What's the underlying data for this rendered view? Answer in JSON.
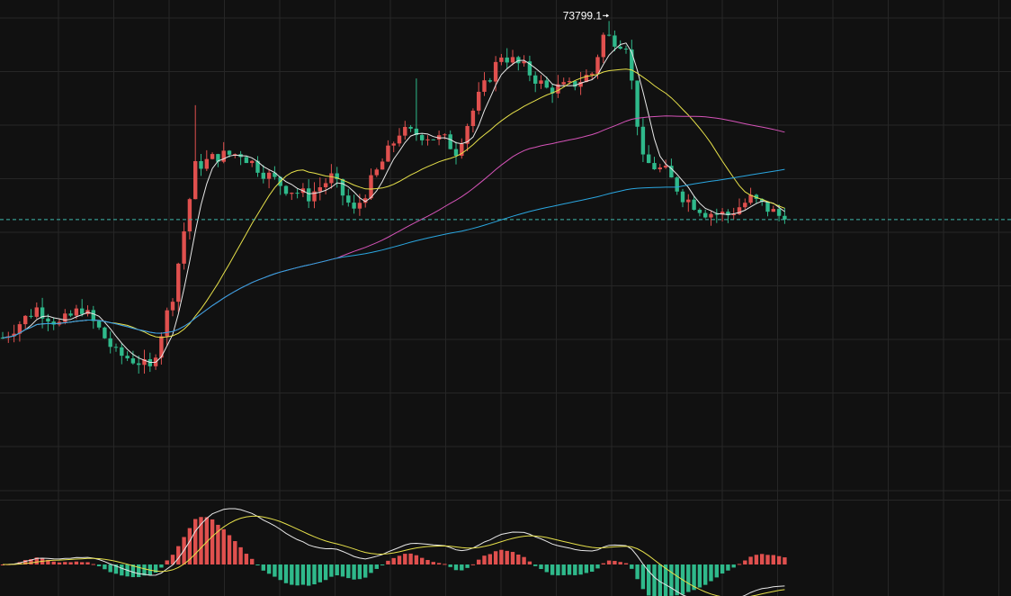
{
  "chart_data": {
    "type": "candlestick",
    "annotations": {
      "high_label": "73799.1"
    },
    "grid": true,
    "colors": {
      "background": "#111111",
      "grid": "#262626",
      "up": "#e0504e",
      "down": "#2fb98b",
      "ma_short": "#e8e8e8",
      "ma_medium": "#e6e04a",
      "ma_long": "#d553b8",
      "ma_longest": "#2aa6e0",
      "macd_dif": "#e8e8e8",
      "macd_dea": "#e6e04a",
      "last_price_line": "#3fb8ad"
    },
    "price_axis_range": [
      59000,
      74500
    ],
    "last_price": 66620,
    "ohlc_waypoints": [
      [
        0,
        62200
      ],
      [
        6,
        63300
      ],
      [
        10,
        62700
      ],
      [
        14,
        63300
      ],
      [
        17,
        62500
      ],
      [
        20,
        61600
      ],
      [
        24,
        61300
      ],
      [
        26,
        61000
      ],
      [
        30,
        63800
      ],
      [
        34,
        68600
      ],
      [
        38,
        69000
      ],
      [
        42,
        69100
      ],
      [
        46,
        68400
      ],
      [
        50,
        67800
      ],
      [
        54,
        67500
      ],
      [
        58,
        68200
      ],
      [
        62,
        66900
      ],
      [
        66,
        68400
      ],
      [
        70,
        69900
      ],
      [
        74,
        69800
      ],
      [
        78,
        69600
      ],
      [
        80,
        69200
      ],
      [
        84,
        71200
      ],
      [
        88,
        72800
      ],
      [
        92,
        72300
      ],
      [
        96,
        71500
      ],
      [
        100,
        71600
      ],
      [
        104,
        72100
      ],
      [
        106,
        73500
      ],
      [
        110,
        73200
      ],
      [
        113,
        68800
      ],
      [
        117,
        68400
      ],
      [
        120,
        67500
      ],
      [
        124,
        66900
      ],
      [
        128,
        66800
      ],
      [
        132,
        67400
      ],
      [
        136,
        66900
      ],
      [
        138,
        66620
      ]
    ],
    "moving_average_periods": [
      5,
      20,
      60,
      120
    ],
    "macd": {
      "fast": 12,
      "slow": 26,
      "signal": 9
    }
  }
}
